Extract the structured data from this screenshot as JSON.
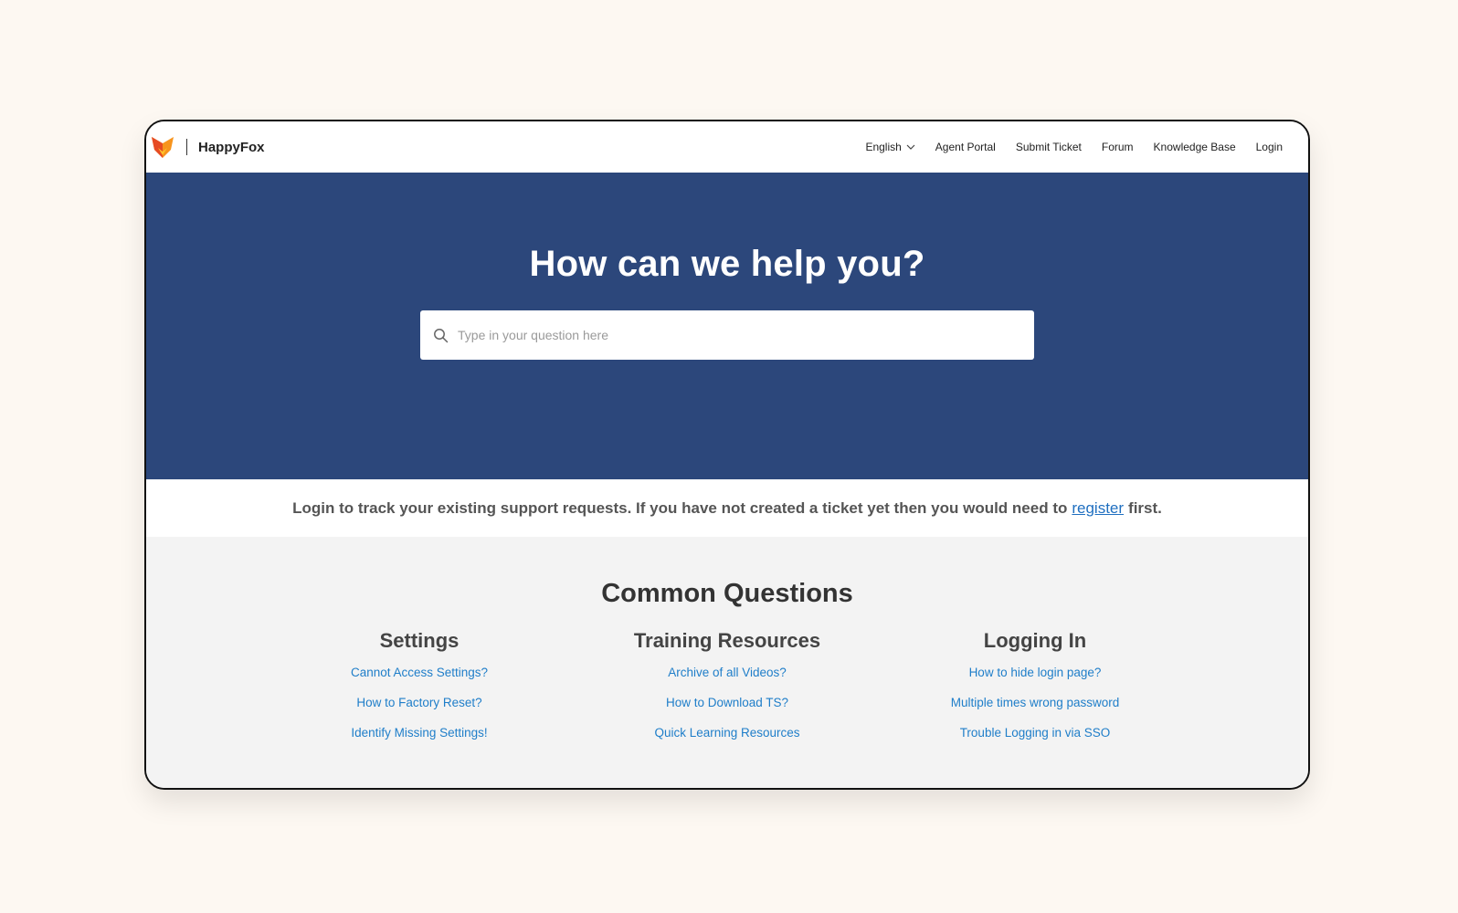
{
  "brand": {
    "name": "HappyFox",
    "logo_colors": [
      "#f7941d",
      "#e64b24",
      "#ffc32b"
    ]
  },
  "nav": {
    "language": "English",
    "items": [
      "Agent Portal",
      "Submit Ticket",
      "Forum",
      "Knowledge Base",
      "Login"
    ]
  },
  "hero": {
    "title": "How can we help you?",
    "search_placeholder": "Type in your question here"
  },
  "notice": {
    "text_before": "Login to track your existing support requests. If you have not created a ticket yet then you would need to",
    "link_text": "register",
    "text_after": "first."
  },
  "common_questions": {
    "title": "Common Questions",
    "categories": [
      {
        "title": "Settings",
        "links": [
          "Cannot Access Settings?",
          "How to Factory Reset?",
          "Identify Missing Settings!"
        ]
      },
      {
        "title": "Training Resources",
        "links": [
          "Archive of all Videos?",
          "How to Download TS?",
          "Quick Learning Resources"
        ]
      },
      {
        "title": "Logging In",
        "links": [
          "How to hide login page?",
          "Multiple times wrong password",
          "Trouble Logging in via SSO"
        ]
      }
    ]
  },
  "colors": {
    "hero_bg": "#2c477b",
    "link": "#1f7ec9",
    "section_bg": "#f3f3f3"
  }
}
